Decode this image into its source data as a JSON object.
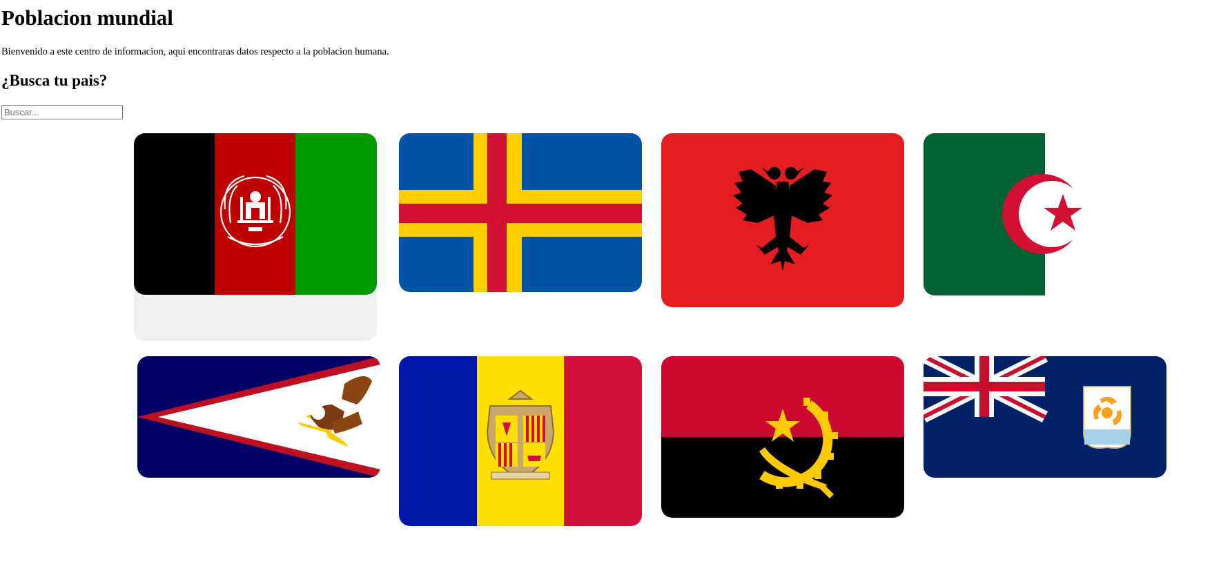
{
  "page": {
    "title": "Poblacion mundial",
    "intro": "Bienvenido a este centro de informacion, aqui encontraras datos respecto a la poblacion humana.",
    "search_heading": "¿Busca tu pais?",
    "search_placeholder": "Buscar..."
  },
  "flags": [
    {
      "country": "Afganistán",
      "icon": "afghanistan-flag-icon",
      "colors": [
        "#000000",
        "#be0000",
        "#009900"
      ]
    },
    {
      "country": "Åland",
      "icon": "aland-flag-icon",
      "colors": [
        "#0053a5",
        "#ffce00",
        "#d21034"
      ]
    },
    {
      "country": "Albania",
      "icon": "albania-flag-icon",
      "colors": [
        "#e41e20",
        "#000000"
      ]
    },
    {
      "country": "Argelia",
      "icon": "algeria-flag-icon",
      "colors": [
        "#006233",
        "#ffffff",
        "#d21034"
      ]
    },
    {
      "country": "Samoa Americana",
      "icon": "american-samoa-flag-icon",
      "colors": [
        "#000066",
        "#bd1021",
        "#ffffff"
      ]
    },
    {
      "country": "Andorra",
      "icon": "andorra-flag-icon",
      "colors": [
        "#0018a8",
        "#fedf00",
        "#d0103a"
      ]
    },
    {
      "country": "Angola",
      "icon": "angola-flag-icon",
      "colors": [
        "#cc092f",
        "#000000",
        "#ffcb00"
      ]
    },
    {
      "country": "Anguila",
      "icon": "anguilla-flag-icon",
      "colors": [
        "#012169",
        "#c8102e",
        "#ffffff",
        "#f9a11b"
      ]
    }
  ]
}
